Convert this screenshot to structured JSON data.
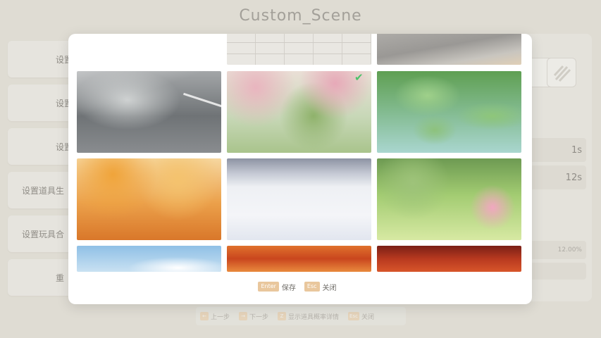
{
  "app": {
    "title": "Custom_Scene"
  },
  "left_menu": [
    {
      "label": "设置背"
    },
    {
      "label": "设置背"
    },
    {
      "label": "设置道"
    },
    {
      "label": "设置道具生"
    },
    {
      "label": "设置玩具合"
    },
    {
      "label": "重"
    }
  ],
  "right_panel": {
    "values": [
      "1s",
      "12s"
    ],
    "percent": "12.00%"
  },
  "bottom_hints": [
    {
      "key": "←",
      "label": "上一步"
    },
    {
      "key": "→",
      "label": "下一步"
    },
    {
      "key": "Z",
      "label": "显示道具概率详情"
    },
    {
      "key": "Esc",
      "label": "关闭"
    }
  ],
  "scene_picker": {
    "selected_index": 4,
    "scenes": [
      {
        "icon": "blank"
      },
      {
        "icon": "white-brick-wall"
      },
      {
        "icon": "grey-pavement"
      },
      {
        "icon": "rainy-street"
      },
      {
        "icon": "cherry-blossom-garden"
      },
      {
        "icon": "lotus-pond"
      },
      {
        "icon": "autumn-forest"
      },
      {
        "icon": "snowy-field"
      },
      {
        "icon": "flower-meadow"
      },
      {
        "icon": "blue-sky-clouds"
      },
      {
        "icon": "red-autumn-leaves"
      },
      {
        "icon": "lava-landscape"
      }
    ],
    "footer": {
      "save_key": "Enter",
      "save_label": "保存",
      "close_key": "Esc",
      "close_label": "关闭"
    },
    "accent_color": "#4bc26a",
    "key_color": "#e9c79d"
  }
}
